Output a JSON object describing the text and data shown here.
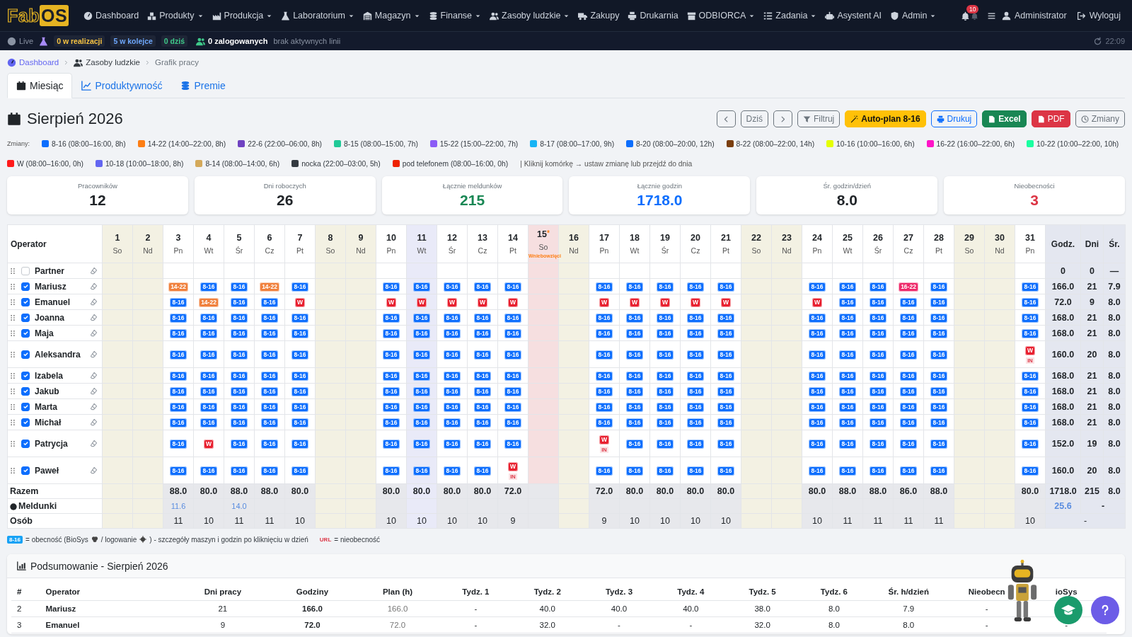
{
  "navbar": {
    "logo": [
      "Fab",
      "OS"
    ],
    "items": [
      {
        "label": "Dashboard",
        "dropdown": false
      },
      {
        "label": "Produkty",
        "dropdown": true
      },
      {
        "label": "Produkcja",
        "dropdown": true
      },
      {
        "label": "Laboratorium",
        "dropdown": true
      },
      {
        "label": "Magazyn",
        "dropdown": true
      },
      {
        "label": "Finanse",
        "dropdown": true
      },
      {
        "label": "Zasoby ludzkie",
        "dropdown": true
      },
      {
        "label": "Zakupy",
        "dropdown": false
      },
      {
        "label": "Drukarnia",
        "dropdown": false
      },
      {
        "label": "ODBIORCA",
        "dropdown": true
      },
      {
        "label": "Zadania",
        "dropdown": true
      },
      {
        "label": "Asystent AI",
        "dropdown": false
      },
      {
        "label": "Admin",
        "dropdown": true
      }
    ],
    "notifications_badge": "10",
    "user": "Administrator",
    "logout": "Wyloguj"
  },
  "status_bar": {
    "live": "Live",
    "badges": [
      {
        "label": "0 w realizacji",
        "color": "#f5c242"
      },
      {
        "label": "5 w kolejce",
        "color": "#6ea8fe"
      },
      {
        "label": "0 dziś",
        "color": "#3fc98a"
      }
    ],
    "logged_in": "0 zalogowanych",
    "lines": "brak aktywnych linii",
    "time": "22:09"
  },
  "breadcrumb": [
    "Dashboard",
    "Zasoby ludzkie",
    "Grafik pracy"
  ],
  "tabs": [
    {
      "label": "Miesiąc",
      "selected": true
    },
    {
      "label": "Produktywność",
      "selected": false
    },
    {
      "label": "Premie",
      "selected": false
    }
  ],
  "title": "Sierpień 2026",
  "toolbar": [
    {
      "kind": "prev"
    },
    {
      "kind": "today",
      "label": "Dziś"
    },
    {
      "kind": "next"
    },
    {
      "kind": "filter",
      "label": "Filtruj"
    },
    {
      "kind": "autoplan",
      "label": "Auto-plan 8-16"
    },
    {
      "kind": "print",
      "label": "Drukuj"
    },
    {
      "kind": "excel",
      "label": "Excel"
    },
    {
      "kind": "pdf",
      "label": "PDF"
    },
    {
      "kind": "changes",
      "label": "Zmiany"
    }
  ],
  "legend": {
    "label": "Zmiany:",
    "items": [
      {
        "label": "8-16 (08:00–16:00, 8h)",
        "color": "#0d6efd"
      },
      {
        "label": "14-22 (14:00–22:00, 8h)",
        "color": "#fd7e14"
      },
      {
        "label": "22-6 (22:00–06:00, 8h)",
        "color": "#6f42c1"
      },
      {
        "label": "8-15 (08:00–15:00, 7h)",
        "color": "#20c997"
      },
      {
        "label": "15-22 (15:00–22:00, 7h)",
        "color": "#8b5cf6"
      },
      {
        "label": "8-17 (08:00–17:00, 9h)",
        "color": "#17b4f5"
      },
      {
        "label": "8-20 (08:00–20:00, 12h)",
        "color": "#0d6efd"
      },
      {
        "label": "8-22 (08:00–22:00, 14h)",
        "color": "#7a3e0e"
      },
      {
        "label": "10-16 (10:00–16:00, 6h)",
        "color": "#e5ff00"
      },
      {
        "label": "16-22 (16:00–22:00, 6h)",
        "color": "#ff14c8"
      },
      {
        "label": "10-22 (10:00–22:00, 10h)",
        "color": "#1affa0"
      },
      {
        "label": "W (08:00–16:00, 0h)",
        "color": "#ff1a1a"
      },
      {
        "label": "10-18 (10:00–18:00, 8h)",
        "color": "#6366f1"
      },
      {
        "label": "8-14 (08:00–14:00, 6h)",
        "color": "#d4a95a"
      },
      {
        "label": "nocka (22:00–03:00, 5h)",
        "color": "#343a40"
      },
      {
        "label": "pod telefonem (08:00–16:00, 0h)",
        "color": "#ee2200"
      }
    ],
    "hint": "| Kliknij komórkę → ustaw zmianę lub przejdź do dnia"
  },
  "stats": [
    {
      "label": "Pracowników",
      "value": "12",
      "color": "#212529"
    },
    {
      "label": "Dni roboczych",
      "value": "26",
      "color": "#212529"
    },
    {
      "label": "Łącznie meldunków",
      "value": "215",
      "color": "#198754"
    },
    {
      "label": "Łącznie godzin",
      "value": "1718.0",
      "color": "#0d6efd"
    },
    {
      "label": "Śr. godzin/dzień",
      "value": "8.0",
      "color": "#212529"
    },
    {
      "label": "Nieobecności",
      "value": "3",
      "color": "#dc3545"
    }
  ],
  "schedule": {
    "operator_header": "Operator",
    "days": [
      {
        "day": "1",
        "dow": "So",
        "kind": "weekend"
      },
      {
        "day": "2",
        "dow": "Nd",
        "kind": "weekend"
      },
      {
        "day": "3",
        "dow": "Pn",
        "kind": "workday"
      },
      {
        "day": "4",
        "dow": "Wt",
        "kind": "workday"
      },
      {
        "day": "5",
        "dow": "Śr",
        "kind": "workday"
      },
      {
        "day": "6",
        "dow": "Cz",
        "kind": "workday"
      },
      {
        "day": "7",
        "dow": "Pt",
        "kind": "workday"
      },
      {
        "day": "8",
        "dow": "So",
        "kind": "weekend"
      },
      {
        "day": "9",
        "dow": "Nd",
        "kind": "weekend"
      },
      {
        "day": "10",
        "dow": "Pn",
        "kind": "workday"
      },
      {
        "day": "11",
        "dow": "Wt",
        "kind": "today"
      },
      {
        "day": "12",
        "dow": "Śr",
        "kind": "workday"
      },
      {
        "day": "13",
        "dow": "Cz",
        "kind": "workday"
      },
      {
        "day": "14",
        "dow": "Pt",
        "kind": "workday"
      },
      {
        "day": "15",
        "dow": "So",
        "kind": "holiday",
        "star": "*",
        "note": "Wniebowzięci"
      },
      {
        "day": "16",
        "dow": "Nd",
        "kind": "weekend"
      },
      {
        "day": "17",
        "dow": "Pn",
        "kind": "workday"
      },
      {
        "day": "18",
        "dow": "Wt",
        "kind": "workday"
      },
      {
        "day": "19",
        "dow": "Śr",
        "kind": "workday"
      },
      {
        "day": "20",
        "dow": "Cz",
        "kind": "workday"
      },
      {
        "day": "21",
        "dow": "Pt",
        "kind": "workday"
      },
      {
        "day": "22",
        "dow": "So",
        "kind": "weekend"
      },
      {
        "day": "23",
        "dow": "Nd",
        "kind": "weekend"
      },
      {
        "day": "24",
        "dow": "Pn",
        "kind": "workday"
      },
      {
        "day": "25",
        "dow": "Wt",
        "kind": "workday"
      },
      {
        "day": "26",
        "dow": "Śr",
        "kind": "workday"
      },
      {
        "day": "27",
        "dow": "Cz",
        "kind": "workday"
      },
      {
        "day": "28",
        "dow": "Pt",
        "kind": "workday"
      },
      {
        "day": "29",
        "dow": "So",
        "kind": "weekend"
      },
      {
        "day": "30",
        "dow": "Nd",
        "kind": "weekend"
      },
      {
        "day": "31",
        "dow": "Pn",
        "kind": "workday"
      }
    ],
    "total_headers": [
      "Godz.",
      "Dni",
      "Śr."
    ],
    "rows": [
      {
        "name": "Partner",
        "checked": false,
        "hours": "0",
        "days": "0",
        "avg": "—",
        "cells": [
          null,
          null,
          null,
          null,
          null,
          null,
          null,
          null,
          null,
          null,
          null,
          null,
          null,
          null,
          null,
          null,
          null,
          null,
          null,
          null,
          null,
          null,
          null,
          null,
          null,
          null,
          null,
          null,
          null,
          null,
          null
        ]
      },
      {
        "name": "Mariusz",
        "checked": true,
        "hours": "166.0",
        "days": "21",
        "avg": "7.9",
        "cells": [
          null,
          null,
          {
            "code": "14-22",
            "color": "#f0803c"
          },
          {
            "code": "8-16",
            "color": "#0d6efd"
          },
          {
            "code": "8-16",
            "color": "#0d6efd"
          },
          {
            "code": "14-22",
            "color": "#f0803c"
          },
          {
            "code": "8-16",
            "color": "#0d6efd"
          },
          null,
          null,
          {
            "code": "8-16",
            "color": "#0d6efd"
          },
          {
            "code": "8-16",
            "color": "#0d6efd"
          },
          {
            "code": "8-16",
            "color": "#0d6efd"
          },
          {
            "code": "8-16",
            "color": "#0d6efd"
          },
          {
            "code": "8-16",
            "color": "#0d6efd"
          },
          null,
          null,
          {
            "code": "8-16",
            "color": "#0d6efd"
          },
          {
            "code": "8-16",
            "color": "#0d6efd"
          },
          {
            "code": "8-16",
            "color": "#0d6efd"
          },
          {
            "code": "8-16",
            "color": "#0d6efd"
          },
          {
            "code": "8-16",
            "color": "#0d6efd"
          },
          null,
          null,
          {
            "code": "8-16",
            "color": "#0d6efd"
          },
          {
            "code": "8-16",
            "color": "#0d6efd"
          },
          {
            "code": "8-16",
            "color": "#0d6efd"
          },
          {
            "code": "16-22",
            "color": "#ee2a6a"
          },
          {
            "code": "8-16",
            "color": "#0d6efd"
          },
          null,
          null,
          {
            "code": "8-16",
            "color": "#0d6efd"
          }
        ]
      },
      {
        "name": "Emanuel",
        "checked": true,
        "hours": "72.0",
        "days": "9",
        "avg": "8.0",
        "cells": [
          null,
          null,
          {
            "code": "8-16",
            "color": "#0d6efd"
          },
          {
            "code": "14-22",
            "color": "#f0803c"
          },
          {
            "code": "8-16",
            "color": "#0d6efd"
          },
          {
            "code": "8-16",
            "color": "#0d6efd"
          },
          {
            "code": "W",
            "color": "#e8202f"
          },
          null,
          null,
          {
            "code": "W",
            "color": "#e8202f"
          },
          {
            "code": "W",
            "color": "#e8202f"
          },
          {
            "code": "W",
            "color": "#e8202f"
          },
          {
            "code": "W",
            "color": "#e8202f"
          },
          {
            "code": "W",
            "color": "#e8202f"
          },
          null,
          null,
          {
            "code": "W",
            "color": "#e8202f"
          },
          {
            "code": "W",
            "color": "#e8202f"
          },
          {
            "code": "W",
            "color": "#e8202f"
          },
          {
            "code": "W",
            "color": "#e8202f"
          },
          {
            "code": "W",
            "color": "#e8202f"
          },
          null,
          null,
          {
            "code": "W",
            "color": "#e8202f"
          },
          {
            "code": "8-16",
            "color": "#0d6efd"
          },
          {
            "code": "8-16",
            "color": "#0d6efd"
          },
          {
            "code": "8-16",
            "color": "#0d6efd"
          },
          {
            "code": "8-16",
            "color": "#0d6efd"
          },
          null,
          null,
          {
            "code": "8-16",
            "color": "#0d6efd"
          }
        ]
      },
      {
        "name": "Joanna",
        "checked": true,
        "hours": "168.0",
        "days": "21",
        "avg": "8.0",
        "cells": [
          null,
          null,
          {
            "code": "8-16",
            "color": "#0d6efd"
          },
          {
            "code": "8-16",
            "color": "#0d6efd"
          },
          {
            "code": "8-16",
            "color": "#0d6efd"
          },
          {
            "code": "8-16",
            "color": "#0d6efd"
          },
          {
            "code": "8-16",
            "color": "#0d6efd"
          },
          null,
          null,
          {
            "code": "8-16",
            "color": "#0d6efd"
          },
          {
            "code": "8-16",
            "color": "#0d6efd"
          },
          {
            "code": "8-16",
            "color": "#0d6efd"
          },
          {
            "code": "8-16",
            "color": "#0d6efd"
          },
          {
            "code": "8-16",
            "color": "#0d6efd"
          },
          null,
          null,
          {
            "code": "8-16",
            "color": "#0d6efd"
          },
          {
            "code": "8-16",
            "color": "#0d6efd"
          },
          {
            "code": "8-16",
            "color": "#0d6efd"
          },
          {
            "code": "8-16",
            "color": "#0d6efd"
          },
          {
            "code": "8-16",
            "color": "#0d6efd"
          },
          null,
          null,
          {
            "code": "8-16",
            "color": "#0d6efd"
          },
          {
            "code": "8-16",
            "color": "#0d6efd"
          },
          {
            "code": "8-16",
            "color": "#0d6efd"
          },
          {
            "code": "8-16",
            "color": "#0d6efd"
          },
          {
            "code": "8-16",
            "color": "#0d6efd"
          },
          null,
          null,
          {
            "code": "8-16",
            "color": "#0d6efd"
          }
        ]
      },
      {
        "name": "Maja",
        "checked": true,
        "hours": "168.0",
        "days": "21",
        "avg": "8.0",
        "cells": [
          null,
          null,
          {
            "code": "8-16",
            "color": "#0d6efd"
          },
          {
            "code": "8-16",
            "color": "#0d6efd"
          },
          {
            "code": "8-16",
            "color": "#0d6efd"
          },
          {
            "code": "8-16",
            "color": "#0d6efd"
          },
          {
            "code": "8-16",
            "color": "#0d6efd"
          },
          null,
          null,
          {
            "code": "8-16",
            "color": "#0d6efd"
          },
          {
            "code": "8-16",
            "color": "#0d6efd"
          },
          {
            "code": "8-16",
            "color": "#0d6efd"
          },
          {
            "code": "8-16",
            "color": "#0d6efd"
          },
          {
            "code": "8-16",
            "color": "#0d6efd"
          },
          null,
          null,
          {
            "code": "8-16",
            "color": "#0d6efd"
          },
          {
            "code": "8-16",
            "color": "#0d6efd"
          },
          {
            "code": "8-16",
            "color": "#0d6efd"
          },
          {
            "code": "8-16",
            "color": "#0d6efd"
          },
          {
            "code": "8-16",
            "color": "#0d6efd"
          },
          null,
          null,
          {
            "code": "8-16",
            "color": "#0d6efd"
          },
          {
            "code": "8-16",
            "color": "#0d6efd"
          },
          {
            "code": "8-16",
            "color": "#0d6efd"
          },
          {
            "code": "8-16",
            "color": "#0d6efd"
          },
          {
            "code": "8-16",
            "color": "#0d6efd"
          },
          null,
          null,
          {
            "code": "8-16",
            "color": "#0d6efd"
          }
        ]
      },
      {
        "name": "Aleksandra",
        "checked": true,
        "hours": "160.0",
        "days": "20",
        "avg": "8.0",
        "cells": [
          null,
          null,
          {
            "code": "8-16",
            "color": "#0d6efd"
          },
          {
            "code": "8-16",
            "color": "#0d6efd"
          },
          {
            "code": "8-16",
            "color": "#0d6efd"
          },
          {
            "code": "8-16",
            "color": "#0d6efd"
          },
          {
            "code": "8-16",
            "color": "#0d6efd"
          },
          null,
          null,
          {
            "code": "8-16",
            "color": "#0d6efd"
          },
          {
            "code": "8-16",
            "color": "#0d6efd"
          },
          {
            "code": "8-16",
            "color": "#0d6efd"
          },
          {
            "code": "8-16",
            "color": "#0d6efd"
          },
          {
            "code": "8-16",
            "color": "#0d6efd"
          },
          null,
          null,
          {
            "code": "8-16",
            "color": "#0d6efd"
          },
          {
            "code": "8-16",
            "color": "#0d6efd"
          },
          {
            "code": "8-16",
            "color": "#0d6efd"
          },
          {
            "code": "8-16",
            "color": "#0d6efd"
          },
          {
            "code": "8-16",
            "color": "#0d6efd"
          },
          null,
          null,
          {
            "code": "8-16",
            "color": "#0d6efd"
          },
          {
            "code": "8-16",
            "color": "#0d6efd"
          },
          {
            "code": "8-16",
            "color": "#0d6efd"
          },
          {
            "code": "8-16",
            "color": "#0d6efd"
          },
          {
            "code": "8-16",
            "color": "#0d6efd"
          },
          null,
          null,
          {
            "code": "W",
            "color": "#e8202f",
            "note": "IN"
          }
        ]
      },
      {
        "name": "Izabela",
        "checked": true,
        "hours": "168.0",
        "days": "21",
        "avg": "8.0",
        "cells": [
          null,
          null,
          {
            "code": "8-16",
            "color": "#0d6efd"
          },
          {
            "code": "8-16",
            "color": "#0d6efd"
          },
          {
            "code": "8-16",
            "color": "#0d6efd"
          },
          {
            "code": "8-16",
            "color": "#0d6efd"
          },
          {
            "code": "8-16",
            "color": "#0d6efd"
          },
          null,
          null,
          {
            "code": "8-16",
            "color": "#0d6efd"
          },
          {
            "code": "8-16",
            "color": "#0d6efd"
          },
          {
            "code": "8-16",
            "color": "#0d6efd"
          },
          {
            "code": "8-16",
            "color": "#0d6efd"
          },
          {
            "code": "8-16",
            "color": "#0d6efd"
          },
          null,
          null,
          {
            "code": "8-16",
            "color": "#0d6efd"
          },
          {
            "code": "8-16",
            "color": "#0d6efd"
          },
          {
            "code": "8-16",
            "color": "#0d6efd"
          },
          {
            "code": "8-16",
            "color": "#0d6efd"
          },
          {
            "code": "8-16",
            "color": "#0d6efd"
          },
          null,
          null,
          {
            "code": "8-16",
            "color": "#0d6efd"
          },
          {
            "code": "8-16",
            "color": "#0d6efd"
          },
          {
            "code": "8-16",
            "color": "#0d6efd"
          },
          {
            "code": "8-16",
            "color": "#0d6efd"
          },
          {
            "code": "8-16",
            "color": "#0d6efd"
          },
          null,
          null,
          {
            "code": "8-16",
            "color": "#0d6efd"
          }
        ]
      },
      {
        "name": "Jakub",
        "checked": true,
        "hours": "168.0",
        "days": "21",
        "avg": "8.0",
        "cells": [
          null,
          null,
          {
            "code": "8-16",
            "color": "#0d6efd"
          },
          {
            "code": "8-16",
            "color": "#0d6efd"
          },
          {
            "code": "8-16",
            "color": "#0d6efd"
          },
          {
            "code": "8-16",
            "color": "#0d6efd"
          },
          {
            "code": "8-16",
            "color": "#0d6efd"
          },
          null,
          null,
          {
            "code": "8-16",
            "color": "#0d6efd"
          },
          {
            "code": "8-16",
            "color": "#0d6efd"
          },
          {
            "code": "8-16",
            "color": "#0d6efd"
          },
          {
            "code": "8-16",
            "color": "#0d6efd"
          },
          {
            "code": "8-16",
            "color": "#0d6efd"
          },
          null,
          null,
          {
            "code": "8-16",
            "color": "#0d6efd"
          },
          {
            "code": "8-16",
            "color": "#0d6efd"
          },
          {
            "code": "8-16",
            "color": "#0d6efd"
          },
          {
            "code": "8-16",
            "color": "#0d6efd"
          },
          {
            "code": "8-16",
            "color": "#0d6efd"
          },
          null,
          null,
          {
            "code": "8-16",
            "color": "#0d6efd"
          },
          {
            "code": "8-16",
            "color": "#0d6efd"
          },
          {
            "code": "8-16",
            "color": "#0d6efd"
          },
          {
            "code": "8-16",
            "color": "#0d6efd"
          },
          {
            "code": "8-16",
            "color": "#0d6efd"
          },
          null,
          null,
          {
            "code": "8-16",
            "color": "#0d6efd"
          }
        ]
      },
      {
        "name": "Marta",
        "checked": true,
        "hours": "168.0",
        "days": "21",
        "avg": "8.0",
        "cells": [
          null,
          null,
          {
            "code": "8-16",
            "color": "#0d6efd"
          },
          {
            "code": "8-16",
            "color": "#0d6efd"
          },
          {
            "code": "8-16",
            "color": "#0d6efd"
          },
          {
            "code": "8-16",
            "color": "#0d6efd"
          },
          {
            "code": "8-16",
            "color": "#0d6efd"
          },
          null,
          null,
          {
            "code": "8-16",
            "color": "#0d6efd"
          },
          {
            "code": "8-16",
            "color": "#0d6efd"
          },
          {
            "code": "8-16",
            "color": "#0d6efd"
          },
          {
            "code": "8-16",
            "color": "#0d6efd"
          },
          {
            "code": "8-16",
            "color": "#0d6efd"
          },
          null,
          null,
          {
            "code": "8-16",
            "color": "#0d6efd"
          },
          {
            "code": "8-16",
            "color": "#0d6efd"
          },
          {
            "code": "8-16",
            "color": "#0d6efd"
          },
          {
            "code": "8-16",
            "color": "#0d6efd"
          },
          {
            "code": "8-16",
            "color": "#0d6efd"
          },
          null,
          null,
          {
            "code": "8-16",
            "color": "#0d6efd"
          },
          {
            "code": "8-16",
            "color": "#0d6efd"
          },
          {
            "code": "8-16",
            "color": "#0d6efd"
          },
          {
            "code": "8-16",
            "color": "#0d6efd"
          },
          {
            "code": "8-16",
            "color": "#0d6efd"
          },
          null,
          null,
          {
            "code": "8-16",
            "color": "#0d6efd"
          }
        ]
      },
      {
        "name": "Michał",
        "checked": true,
        "hours": "168.0",
        "days": "21",
        "avg": "8.0",
        "cells": [
          null,
          null,
          {
            "code": "8-16",
            "color": "#0d6efd"
          },
          {
            "code": "8-16",
            "color": "#0d6efd"
          },
          {
            "code": "8-16",
            "color": "#0d6efd"
          },
          {
            "code": "8-16",
            "color": "#0d6efd"
          },
          {
            "code": "8-16",
            "color": "#0d6efd"
          },
          null,
          null,
          {
            "code": "8-16",
            "color": "#0d6efd"
          },
          {
            "code": "8-16",
            "color": "#0d6efd"
          },
          {
            "code": "8-16",
            "color": "#0d6efd"
          },
          {
            "code": "8-16",
            "color": "#0d6efd"
          },
          {
            "code": "8-16",
            "color": "#0d6efd"
          },
          null,
          null,
          {
            "code": "8-16",
            "color": "#0d6efd"
          },
          {
            "code": "8-16",
            "color": "#0d6efd"
          },
          {
            "code": "8-16",
            "color": "#0d6efd"
          },
          {
            "code": "8-16",
            "color": "#0d6efd"
          },
          {
            "code": "8-16",
            "color": "#0d6efd"
          },
          null,
          null,
          {
            "code": "8-16",
            "color": "#0d6efd"
          },
          {
            "code": "8-16",
            "color": "#0d6efd"
          },
          {
            "code": "8-16",
            "color": "#0d6efd"
          },
          {
            "code": "8-16",
            "color": "#0d6efd"
          },
          {
            "code": "8-16",
            "color": "#0d6efd"
          },
          null,
          null,
          {
            "code": "8-16",
            "color": "#0d6efd"
          }
        ]
      },
      {
        "name": "Patrycja",
        "checked": true,
        "hours": "152.0",
        "days": "19",
        "avg": "8.0",
        "cells": [
          null,
          null,
          {
            "code": "8-16",
            "color": "#0d6efd"
          },
          {
            "code": "W",
            "color": "#e8202f"
          },
          {
            "code": "8-16",
            "color": "#0d6efd"
          },
          {
            "code": "8-16",
            "color": "#0d6efd"
          },
          {
            "code": "8-16",
            "color": "#0d6efd"
          },
          null,
          null,
          {
            "code": "8-16",
            "color": "#0d6efd"
          },
          {
            "code": "8-16",
            "color": "#0d6efd"
          },
          {
            "code": "8-16",
            "color": "#0d6efd"
          },
          {
            "code": "8-16",
            "color": "#0d6efd"
          },
          {
            "code": "8-16",
            "color": "#0d6efd"
          },
          null,
          null,
          {
            "code": "W",
            "color": "#e8202f",
            "note": "IN"
          },
          {
            "code": "8-16",
            "color": "#0d6efd"
          },
          {
            "code": "8-16",
            "color": "#0d6efd"
          },
          {
            "code": "8-16",
            "color": "#0d6efd"
          },
          {
            "code": "8-16",
            "color": "#0d6efd"
          },
          null,
          null,
          {
            "code": "8-16",
            "color": "#0d6efd"
          },
          {
            "code": "8-16",
            "color": "#0d6efd"
          },
          {
            "code": "8-16",
            "color": "#0d6efd"
          },
          {
            "code": "8-16",
            "color": "#0d6efd"
          },
          {
            "code": "8-16",
            "color": "#0d6efd"
          },
          null,
          null,
          {
            "code": "8-16",
            "color": "#0d6efd"
          }
        ]
      },
      {
        "name": "Paweł",
        "checked": true,
        "hours": "160.0",
        "days": "20",
        "avg": "8.0",
        "cells": [
          null,
          null,
          {
            "code": "8-16",
            "color": "#0d6efd"
          },
          {
            "code": "8-16",
            "color": "#0d6efd"
          },
          {
            "code": "8-16",
            "color": "#0d6efd"
          },
          {
            "code": "8-16",
            "color": "#0d6efd"
          },
          {
            "code": "8-16",
            "color": "#0d6efd"
          },
          null,
          null,
          {
            "code": "8-16",
            "color": "#0d6efd"
          },
          {
            "code": "8-16",
            "color": "#0d6efd"
          },
          {
            "code": "8-16",
            "color": "#0d6efd"
          },
          {
            "code": "8-16",
            "color": "#0d6efd"
          },
          {
            "code": "W",
            "color": "#e8202f",
            "note": "IN"
          },
          null,
          null,
          {
            "code": "8-16",
            "color": "#0d6efd"
          },
          {
            "code": "8-16",
            "color": "#0d6efd"
          },
          {
            "code": "8-16",
            "color": "#0d6efd"
          },
          {
            "code": "8-16",
            "color": "#0d6efd"
          },
          {
            "code": "8-16",
            "color": "#0d6efd"
          },
          null,
          null,
          {
            "code": "8-16",
            "color": "#0d6efd"
          },
          {
            "code": "8-16",
            "color": "#0d6efd"
          },
          {
            "code": "8-16",
            "color": "#0d6efd"
          },
          {
            "code": "8-16",
            "color": "#0d6efd"
          },
          {
            "code": "8-16",
            "color": "#0d6efd"
          },
          null,
          null,
          {
            "code": "8-16",
            "color": "#0d6efd"
          }
        ]
      }
    ],
    "totals": {
      "label": "Razem",
      "hours": "1718.0",
      "days": "215",
      "avg": "8.0",
      "cells": [
        null,
        null,
        "88.0",
        "80.0",
        "88.0",
        "88.0",
        "80.0",
        null,
        null,
        "80.0",
        "80.0",
        "80.0",
        "80.0",
        "72.0",
        null,
        null,
        "72.0",
        "80.0",
        "80.0",
        "80.0",
        "80.0",
        null,
        null,
        "80.0",
        "88.0",
        "88.0",
        "86.0",
        "88.0",
        null,
        null,
        "80.0"
      ]
    },
    "reports": {
      "label": "Meldunki",
      "hours": "25.6",
      "days": "-",
      "cells": [
        null,
        null,
        "11.6",
        null,
        "14.0",
        null,
        null,
        null,
        null,
        null,
        null,
        null,
        null,
        null,
        null,
        null,
        null,
        null,
        null,
        null,
        null,
        null,
        null,
        null,
        null,
        null,
        null,
        null,
        null,
        null,
        null
      ]
    },
    "people": {
      "label": "Osób",
      "total": "-",
      "cells": [
        null,
        null,
        "11",
        "10",
        "11",
        "11",
        "10",
        null,
        null,
        "10",
        "10",
        "10",
        "10",
        "9",
        null,
        null,
        "9",
        "10",
        "10",
        "10",
        "10",
        null,
        null,
        "10",
        "11",
        "11",
        "11",
        "11",
        null,
        null,
        "10"
      ]
    }
  },
  "note": {
    "chip": "8-16",
    "text_before": "= obecność (BioSys",
    "text_middle": "/ logowanie",
    "text_after": ") - szczegóły maszyn i godzin po kliknięciu w dzień",
    "absence_code": "URL",
    "absence_text": "= nieobecność"
  },
  "summary": {
    "title": "Podsumowanie - Sierpień 2026",
    "columns": [
      "#",
      "Operator",
      "Dni pracy",
      "Godziny",
      "Plan (h)",
      "Tydz. 1",
      "Tydz. 2",
      "Tydz. 3",
      "Tydz. 4",
      "Tydz. 5",
      "Tydz. 6",
      "Śr. h/dzień",
      "Nieobecn",
      "ioSys"
    ],
    "rows": [
      [
        "2",
        "Mariusz",
        "21",
        "166.0",
        "166.0",
        "-",
        "40.0",
        "40.0",
        "40.0",
        "38.0",
        "8.0",
        "7.9",
        "-",
        null
      ],
      [
        "3",
        "Emanuel",
        "9",
        "72.0",
        "72.0",
        "-",
        "32.0",
        "-",
        "-",
        "32.0",
        "8.0",
        "8.0",
        "-",
        "-"
      ]
    ]
  }
}
